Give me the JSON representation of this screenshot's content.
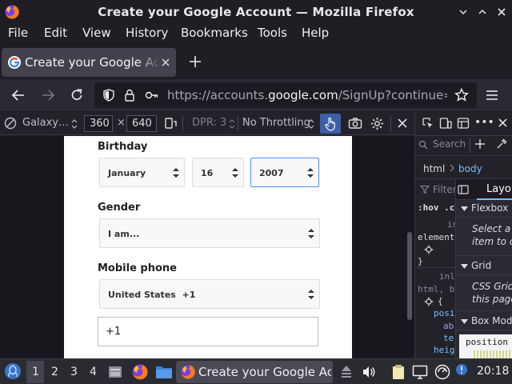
{
  "window": {
    "title": "Create your Google Account — Mozilla Firefox"
  },
  "menu": [
    "File",
    "Edit",
    "View",
    "History",
    "Bookmarks",
    "Tools",
    "Help"
  ],
  "tab": {
    "title": "Create your Google Account"
  },
  "urlbar": {
    "prefix": "https://accounts.",
    "domain": "google.com",
    "suffix": "/SignUp?continue=https"
  },
  "rdm": {
    "device": "Galaxy…",
    "width": "360",
    "times": "×",
    "height": "640",
    "dpr": "DPR: 3",
    "throttling": "No Throttling"
  },
  "form": {
    "birthday_label": "Birthday",
    "month": "January",
    "day": "16",
    "year": "2007",
    "gender_label": "Gender",
    "gender_value": "I am...",
    "phone_label": "Mobile phone",
    "country": "United States  +1",
    "phone_value": "+1"
  },
  "devtools": {
    "search_placeholder": "Search",
    "crumb_html": "html",
    "crumb_body": "body",
    "filter_placeholder": "Filter",
    "hov_cls": ":hov .cl",
    "layout_tab": "Layout",
    "flexbox": "Flexbox",
    "flex_note_1": "Select a",
    "flex_note_2": "item to c",
    "grid": "Grid",
    "grid_note_1": "CSS Grid",
    "grid_note_2": "this page",
    "boxmodel": "Box Mod",
    "position_label": "position",
    "css_lines": [
      "inl",
      "element",
      "}",
      "inl",
      "html, b",
      "{",
      "posi",
      "ab",
      "te",
      "heig"
    ]
  },
  "taskbar": {
    "workspaces": [
      "1",
      "2",
      "3",
      "4"
    ],
    "app_title": "Create your Google Account — Mozilla Firefox",
    "clock": "20:18"
  },
  "colors": {
    "accent": "#4d90fe",
    "dt_blue": "#75bfff",
    "dt_purple": "#b98eff"
  }
}
